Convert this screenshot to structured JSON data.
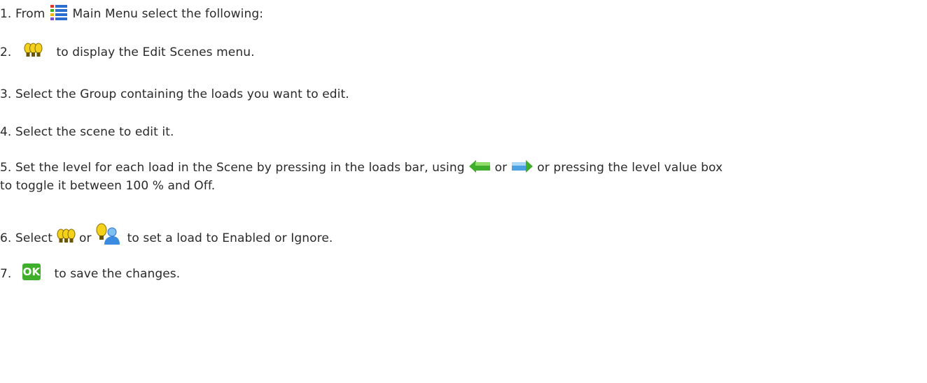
{
  "steps": [
    {
      "num": "1.",
      "pre": "From",
      "post": "Main Menu select the following:",
      "icon": "main-menu-icon"
    },
    {
      "num": "2.",
      "post": "to display the Edit Scenes menu.",
      "icon": "edit-scenes-icon"
    },
    {
      "num": "3.",
      "text": "Select the Group containing the loads you want to edit."
    },
    {
      "num": "4.",
      "text": "Select the scene to edit it."
    },
    {
      "num": "5.",
      "pre": "Set the level for each load in the Scene by pressing in the loads bar, using",
      "mid": "or",
      "post": "or pressing the level value box",
      "line2": "to toggle it between 100 % and Off.",
      "icons": [
        "left-arrow-icon",
        "right-arrow-icon"
      ]
    },
    {
      "num": "6.",
      "pre": "Select",
      "mid": "or",
      "post": "to set a load to Enabled or Ignore.",
      "icons": [
        "enabled-bulbs-icon",
        "ignore-bulb-person-icon"
      ]
    },
    {
      "num": "7.",
      "post": "to save the changes.",
      "icon": "ok-icon",
      "ok_label": "OK"
    }
  ],
  "colors": {
    "text": "#2a2a2a",
    "accent_green": "#3fae2a",
    "bulb_yellow": "#f5d21a",
    "menu_blue": "#2a6fd0"
  }
}
